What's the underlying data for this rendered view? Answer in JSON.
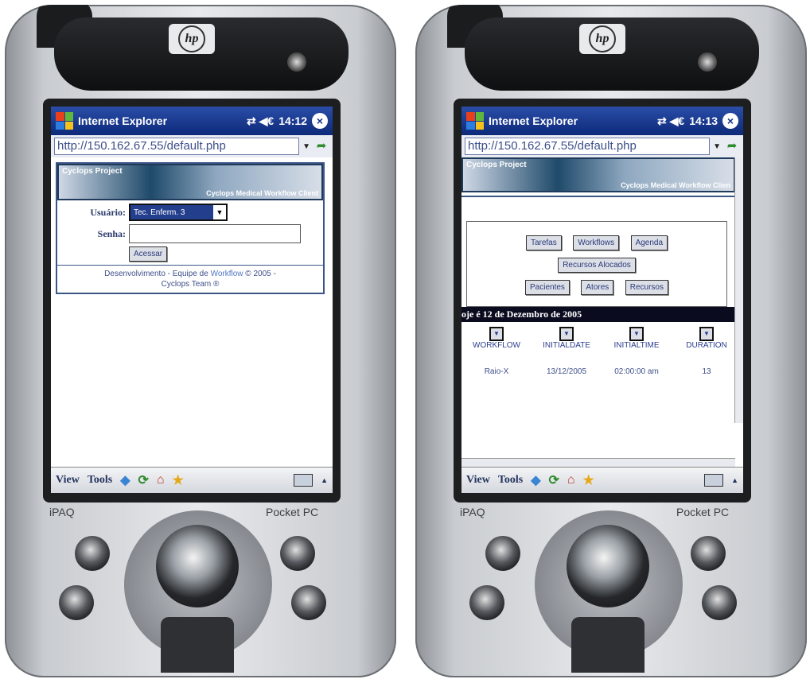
{
  "devices": [
    {
      "brand_logo": "hp",
      "left_brand": "iPAQ",
      "right_brand": "Pocket PC",
      "window": {
        "title": "Internet Explorer",
        "status_icons": "⇄ ◀€",
        "time": "14:12",
        "close_icon": "close-icon"
      },
      "address": "http://150.162.67.55/default.php",
      "banner": {
        "project": "Cyclops Project",
        "subtitle": "Cyclops Medical Workflow Client"
      },
      "login": {
        "user_label": "Usuário:",
        "user_value": "Tec. Enferm. 3",
        "password_label": "Senha:",
        "submit_label": "Acessar"
      },
      "footer": {
        "line1_a": "Desenvolvimento - Equipe de ",
        "line1_wf": "Workflow",
        "line1_b": " © 2005 -",
        "line2": "Cyclops Team ®"
      },
      "taskbar": {
        "view": "View",
        "tools": "Tools"
      }
    },
    {
      "brand_logo": "hp",
      "left_brand": "iPAQ",
      "right_brand": "Pocket PC",
      "window": {
        "title": "Internet Explorer",
        "status_icons": "⇄ ◀€",
        "time": "14:13",
        "close_icon": "close-icon"
      },
      "address": "http://150.162.67.55/default.php",
      "banner": {
        "project": "Cyclops Project",
        "subtitle": "Cyclops Medical Workflow Clien"
      },
      "menu": {
        "row1": [
          "Tarefas",
          "Workflows",
          "Agenda"
        ],
        "row2": [
          "Recursos Alocados"
        ],
        "row3": [
          "Pacientes",
          "Atores",
          "Recursos"
        ]
      },
      "date_text": "oje é 12 de Dezembro de 2005",
      "grid": {
        "headers": [
          "WORKFLOW",
          "INITIALDATE",
          "INITIALTIME",
          "DURATION"
        ],
        "rows": [
          [
            "Raio-X",
            "13/12/2005",
            "02:00:00 am",
            "13"
          ]
        ]
      },
      "taskbar": {
        "view": "View",
        "tools": "Tools"
      }
    }
  ]
}
